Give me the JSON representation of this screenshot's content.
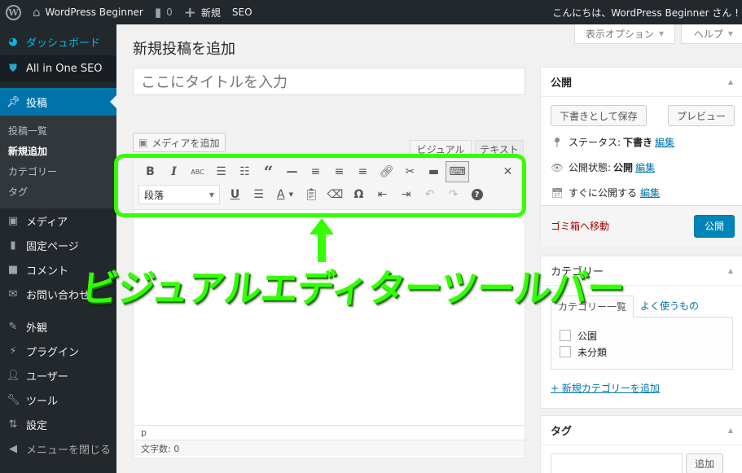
{
  "admin_bar": {
    "site_name": "WordPress Beginner",
    "comments_count": "0",
    "new_label": "新規",
    "seo_label": "SEO",
    "greeting": "こんにちは、WordPress Beginner さん !"
  },
  "sidebar": {
    "items": [
      {
        "label": "ダッシュボード",
        "icon": "dashboard-icon"
      },
      {
        "label": "All in One SEO",
        "icon": "shield-icon"
      },
      {
        "label": "投稿",
        "icon": "pin-icon"
      },
      {
        "label": "メディア",
        "icon": "media-icon"
      },
      {
        "label": "固定ページ",
        "icon": "pages-icon"
      },
      {
        "label": "コメント",
        "icon": "comment-icon"
      },
      {
        "label": "お問い合わせ",
        "icon": "mail-icon"
      },
      {
        "label": "外観",
        "icon": "brush-icon"
      },
      {
        "label": "プラグイン",
        "icon": "plugin-icon"
      },
      {
        "label": "ユーザー",
        "icon": "user-icon"
      },
      {
        "label": "ツール",
        "icon": "wrench-icon"
      },
      {
        "label": "設定",
        "icon": "settings-icon"
      },
      {
        "label": "メニューを閉じる",
        "icon": "collapse-icon"
      }
    ],
    "submenu": [
      "投稿一覧",
      "新規追加",
      "カテゴリー",
      "タグ"
    ]
  },
  "screen_meta": {
    "options": "表示オプション",
    "help": "ヘルプ"
  },
  "page": {
    "title": "新規投稿を追加",
    "title_placeholder": "ここにタイトルを入力"
  },
  "editor": {
    "add_media": "メディアを追加",
    "tab_visual": "ビジュアル",
    "tab_text": "テキスト",
    "format_select": "段落",
    "path": "p",
    "word_count": "文字数: 0"
  },
  "publish": {
    "title": "公開",
    "save_draft": "下書きとして保存",
    "preview": "プレビュー",
    "status_label": "ステータス:",
    "status_value": "下書き",
    "visibility_label": "公開状態:",
    "visibility_value": "公開",
    "schedule_label": "すぐに公開する",
    "edit": "編集",
    "trash": "ゴミ箱へ移動",
    "publish_button": "公開"
  },
  "categories": {
    "title": "カテゴリー",
    "tab_all": "カテゴリー一覧",
    "tab_popular": "よく使うもの",
    "items": [
      "公園",
      "未分類"
    ],
    "add_new": "+ 新規カテゴリーを追加"
  },
  "tags": {
    "title": "タグ",
    "add_button": "追加"
  },
  "annotation": {
    "label": "ビジュアルエディターツールバー",
    "color": "#33ff00"
  }
}
